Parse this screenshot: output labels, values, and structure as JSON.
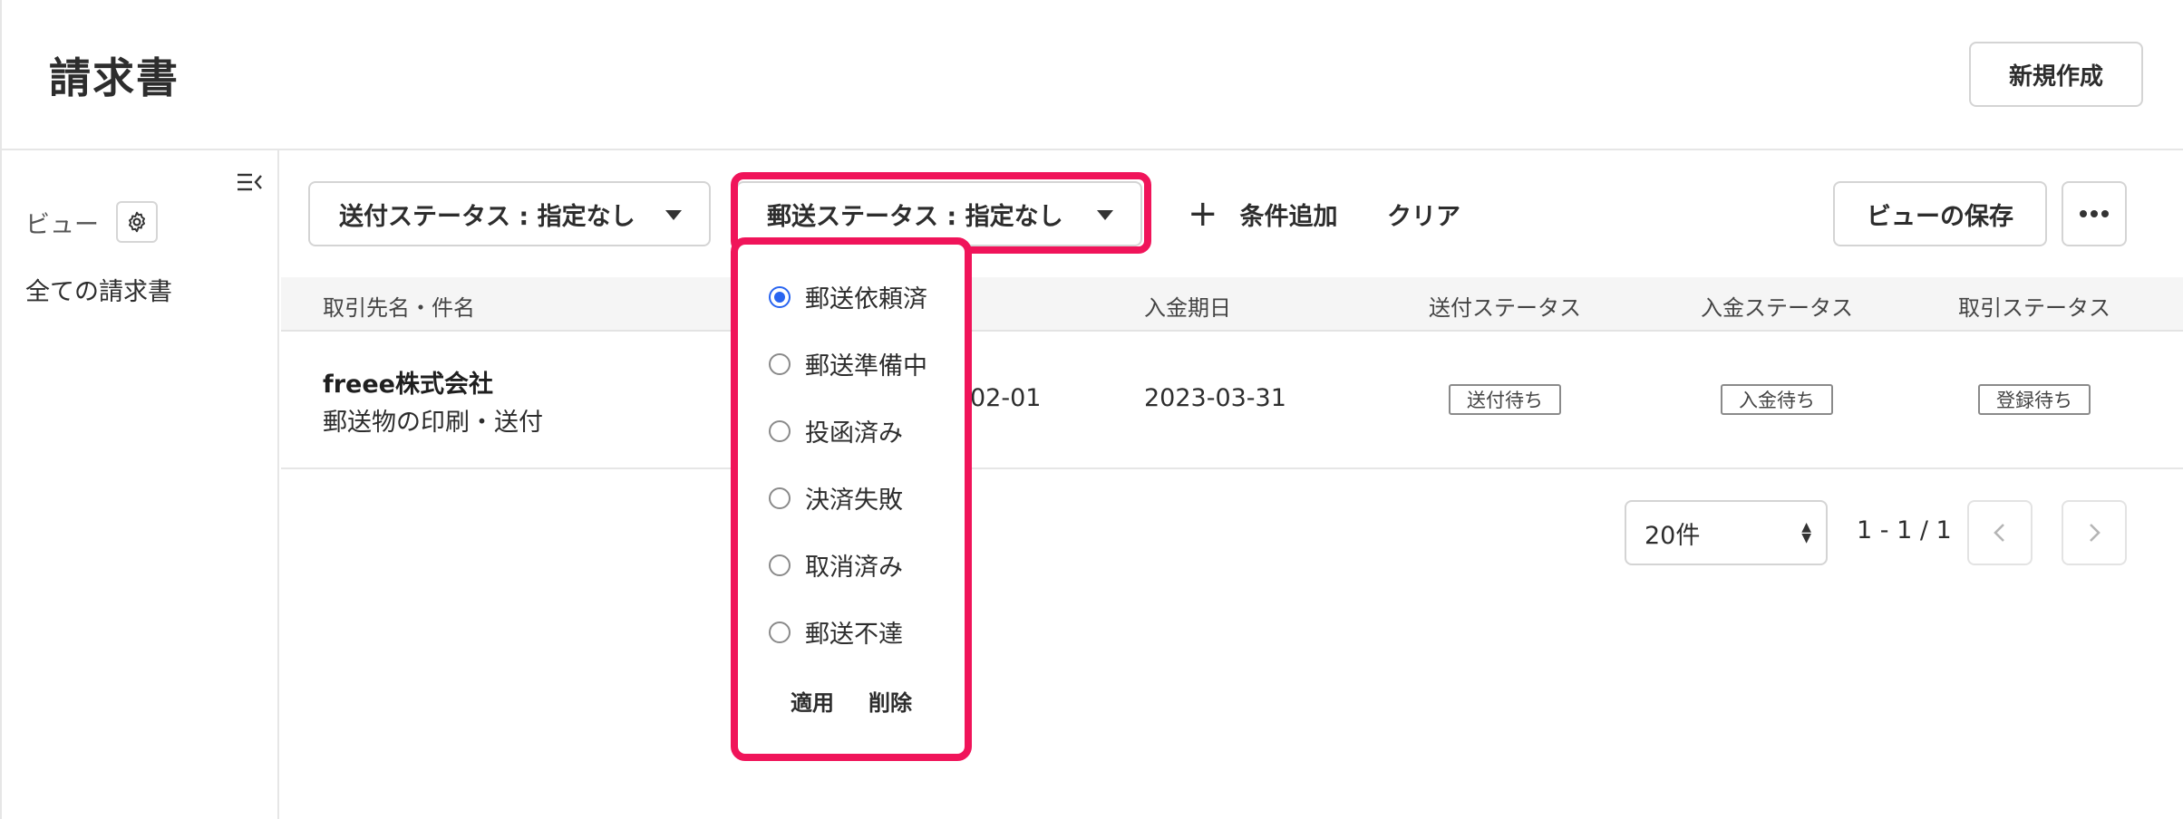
{
  "header": {
    "title": "請求書",
    "new_label": "新規作成"
  },
  "sidebar": {
    "view_label": "ビュー",
    "all_invoices": "全ての請求書"
  },
  "toolbar": {
    "send_status_filter": "送付ステータス : 指定なし",
    "mail_status_filter": "郵送ステータス : 指定なし",
    "add_condition": "条件追加",
    "clear": "クリア",
    "save_view": "ビューの保存"
  },
  "table": {
    "headers": [
      "取引先名・件名",
      "入金期日",
      "送付ステータス",
      "入金ステータス",
      "取引ステータス"
    ],
    "rows": [
      {
        "client": "freee株式会社",
        "subject": "郵送物の印刷・送付",
        "issue_date_partial": "02-01",
        "due_date": "2023-03-31",
        "send_status": "送付待ち",
        "payment_status": "入金待ち",
        "deal_status": "登録待ち"
      }
    ]
  },
  "pagination": {
    "per_page": "20件",
    "range": "1 - 1 / 1"
  },
  "mail_status_dropdown": {
    "options": [
      {
        "label": "郵送依頼済",
        "selected": true
      },
      {
        "label": "郵送準備中",
        "selected": false
      },
      {
        "label": "投函済み",
        "selected": false
      },
      {
        "label": "決済失敗",
        "selected": false
      },
      {
        "label": "取消済み",
        "selected": false
      },
      {
        "label": "郵送不達",
        "selected": false
      }
    ],
    "apply": "適用",
    "delete": "削除"
  },
  "colors": {
    "highlight": "#f0145a",
    "radio_selected": "#2864f0"
  },
  "icons": [
    "collapse-sidebar-icon",
    "gear-icon",
    "plus-icon",
    "caret-down-icon",
    "more-dots-icon",
    "chevron-left-icon",
    "chevron-right-icon"
  ]
}
